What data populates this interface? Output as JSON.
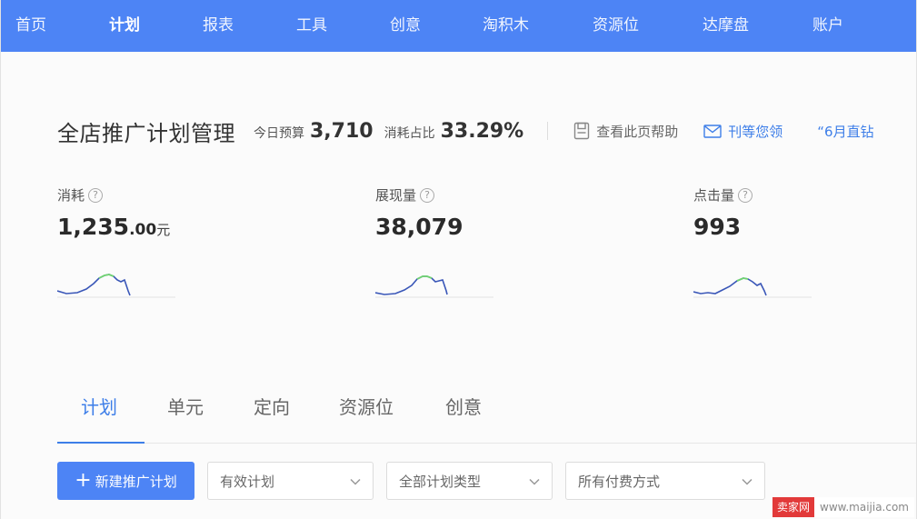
{
  "nav": {
    "items": [
      {
        "label": "首页",
        "active": false
      },
      {
        "label": "计划",
        "active": true
      },
      {
        "label": "报表",
        "active": false
      },
      {
        "label": "工具",
        "active": false
      },
      {
        "label": "创意",
        "active": false
      },
      {
        "label": "淘积木",
        "active": false
      },
      {
        "label": "资源位",
        "active": false
      },
      {
        "label": "达摩盘",
        "active": false
      },
      {
        "label": "账户",
        "active": false
      }
    ]
  },
  "header": {
    "title": "全店推广计划管理",
    "budget_label": "今日预算",
    "budget_value": "3,710",
    "share_label": "消耗占比",
    "share_value": "33.29%",
    "help_label": "查看此页帮助",
    "mail_label": "刊等您领",
    "promo_label": "“6月直钻"
  },
  "metrics": [
    {
      "label": "消耗",
      "help": "?",
      "value_int": "1,235",
      "value_dec": ".00",
      "unit": "元"
    },
    {
      "label": "展现量",
      "help": "?",
      "value_int": "38,079",
      "value_dec": "",
      "unit": ""
    },
    {
      "label": "点击量",
      "help": "?",
      "value_int": "993",
      "value_dec": "",
      "unit": ""
    }
  ],
  "tabs": [
    {
      "label": "计划",
      "active": true
    },
    {
      "label": "单元",
      "active": false
    },
    {
      "label": "定向",
      "active": false
    },
    {
      "label": "资源位",
      "active": false
    },
    {
      "label": "创意",
      "active": false
    }
  ],
  "toolbar": {
    "new_plan_label": "新建推广计划",
    "filters": [
      {
        "selected": "有效计划"
      },
      {
        "selected": "全部计划类型"
      },
      {
        "selected": "所有付费方式"
      }
    ]
  },
  "watermark": {
    "badge": "卖家网",
    "url": "www.maijia.com"
  },
  "colors": {
    "nav_bg": "#4d84f5",
    "accent": "#3d7ee8",
    "spark_line": "#3a57b8",
    "spark_highlight": "#6fd36f"
  }
}
